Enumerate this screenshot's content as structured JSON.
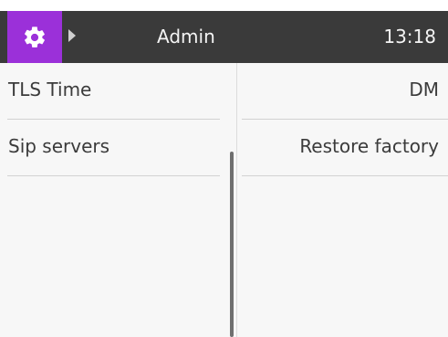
{
  "header": {
    "title": "Admin",
    "time": "13:18",
    "settings_icon": "gear-icon",
    "arrow_icon": "triangle-right-icon",
    "accent_color": "#9b30d9",
    "bar_color": "#3a3a3a"
  },
  "menu": {
    "left": [
      {
        "label": "TLS Time"
      },
      {
        "label": "Sip servers"
      }
    ],
    "right": [
      {
        "label": "DM"
      },
      {
        "label": "Restore factory"
      }
    ]
  }
}
